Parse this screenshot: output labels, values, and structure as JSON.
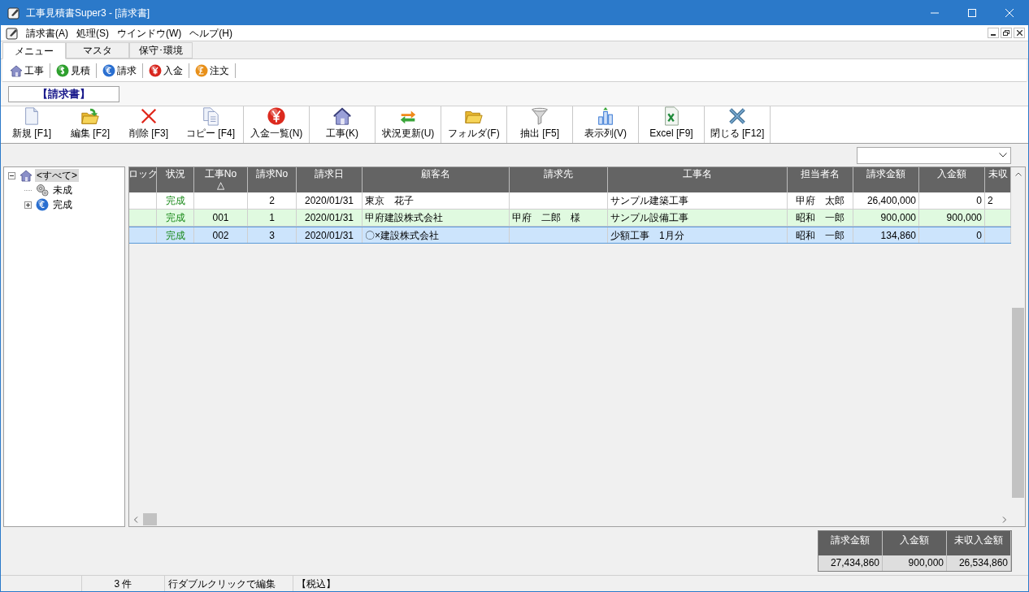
{
  "window": {
    "title": "工事見積書Super3 - [請求書]"
  },
  "menu": [
    {
      "label": "請求書(A)"
    },
    {
      "label": "処理(S)"
    },
    {
      "label": "ウインドウ(W)"
    },
    {
      "label": "ヘルプ(H)"
    }
  ],
  "tabs": [
    {
      "label": "メニュー",
      "selected": true
    },
    {
      "label": "マスタ",
      "selected": false
    },
    {
      "label": "保守･環境",
      "selected": false
    }
  ],
  "quick_bar": [
    {
      "label": "工事",
      "kind": "house"
    },
    {
      "label": "見積",
      "kind": "dollar"
    },
    {
      "label": "請求",
      "kind": "euro"
    },
    {
      "label": "入金",
      "kind": "yen"
    },
    {
      "label": "注文",
      "kind": "pound"
    }
  ],
  "page_title": "【請求書】",
  "toolbar": [
    {
      "label": "新規 [F1]",
      "kind": "new"
    },
    {
      "label": "編集 [F2]",
      "kind": "edit"
    },
    {
      "label": "削除 [F3]",
      "kind": "delete"
    },
    {
      "label": "コピー [F4]",
      "kind": "copy"
    },
    {
      "label": "入金一覧(N)",
      "kind": "yen"
    },
    {
      "label": "工事(K)",
      "kind": "house"
    },
    {
      "label": "状況更新(U)",
      "kind": "refresh"
    },
    {
      "label": "フォルダ(F)",
      "kind": "folder"
    },
    {
      "label": "抽出 [F5]",
      "kind": "filter"
    },
    {
      "label": "表示列(V)",
      "kind": "columns"
    },
    {
      "label": "Excel [F9]",
      "kind": "excel"
    },
    {
      "label": "閉じる [F12]",
      "kind": "close"
    }
  ],
  "tree": [
    {
      "label": "<すべて>",
      "kind": "house",
      "selected": true,
      "expanded": true,
      "children": [
        {
          "label": "未成",
          "kind": "gears",
          "selected": false
        },
        {
          "label": "完成",
          "kind": "euro",
          "selected": false,
          "expanded": false
        }
      ]
    }
  ],
  "table": {
    "columns": [
      {
        "label": "ロック"
      },
      {
        "label": "状況"
      },
      {
        "label": "工事No",
        "sort_mark": "△"
      },
      {
        "label": "請求No"
      },
      {
        "label": "請求日"
      },
      {
        "label": "顧客名"
      },
      {
        "label": "請求先"
      },
      {
        "label": "工事名"
      },
      {
        "label": "担当者名"
      },
      {
        "label": "請求金額"
      },
      {
        "label": "入金額"
      },
      {
        "label": "未収"
      }
    ],
    "rows": [
      {
        "selected": false,
        "color": "#ffffff",
        "cells": [
          "",
          "完成",
          "",
          "2",
          "2020/01/31",
          "東京　花子",
          "",
          "サンプル建築工事",
          "甲府　太郎",
          "26,400,000",
          "0",
          "2"
        ]
      },
      {
        "selected": false,
        "color": "#e0fae0",
        "cells": [
          "",
          "完成",
          "001",
          "1",
          "2020/01/31",
          "甲府建設株式会社",
          "甲府　二郎　様",
          "サンプル設備工事",
          "昭和　一郎",
          "900,000",
          "900,000",
          ""
        ]
      },
      {
        "selected": true,
        "color": "#cce4fc",
        "cells": [
          "",
          "完成",
          "002",
          "3",
          "2020/01/31",
          "〇×建設株式会社",
          "",
          "少額工事　1月分",
          "昭和　一郎",
          "134,860",
          "0",
          ""
        ]
      }
    ]
  },
  "totals": {
    "columns": [
      "請求金額",
      "入金額",
      "未収入金額"
    ],
    "values": [
      "27,434,860",
      "900,000",
      "26,534,860"
    ]
  },
  "status_bar": [
    "3 件",
    "行ダブルクリックで編集",
    "【税込】"
  ]
}
